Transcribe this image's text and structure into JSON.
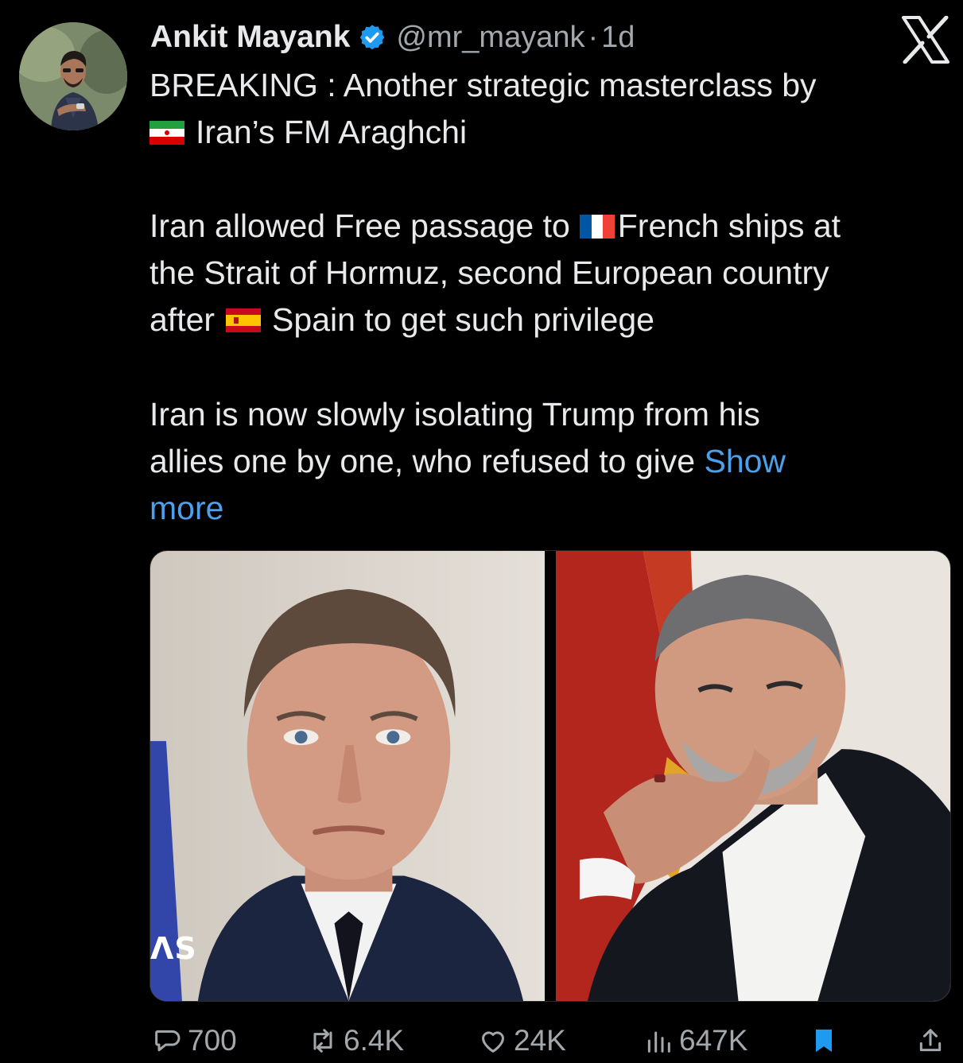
{
  "author": {
    "name": "Ankit Mayank",
    "handle": "@mr_mayank",
    "separator": "·",
    "time": "1d",
    "verified_icon": "verified-badge-icon"
  },
  "platform_icon": "x-logo-icon",
  "post": {
    "line1": "BREAKING : Another strategic masterclass by",
    "line2": "Iran’s FM Araghchi",
    "line3_pre": "Iran allowed Free passage to",
    "line3_post": "French ships at",
    "line4": "the Strait of Hormuz, second European country",
    "line5_pre": "after",
    "line5_post": "Spain to get such privilege",
    "line6": "Iran is now slowly isolating Trump from his",
    "line7": "allies one by one, who refused to give",
    "show": "Show",
    "more": "more"
  },
  "media": {
    "watermark": "ɅS"
  },
  "actions": {
    "replies": "700",
    "reposts": "6.4K",
    "likes": "24K",
    "views": "647K"
  },
  "colors": {
    "background": "#000000",
    "text": "#e7e9ea",
    "muted": "#a3a8ad",
    "link": "#4c9fe8",
    "verified": "#1d9bf0",
    "bookmark": "#1d9bf0"
  }
}
